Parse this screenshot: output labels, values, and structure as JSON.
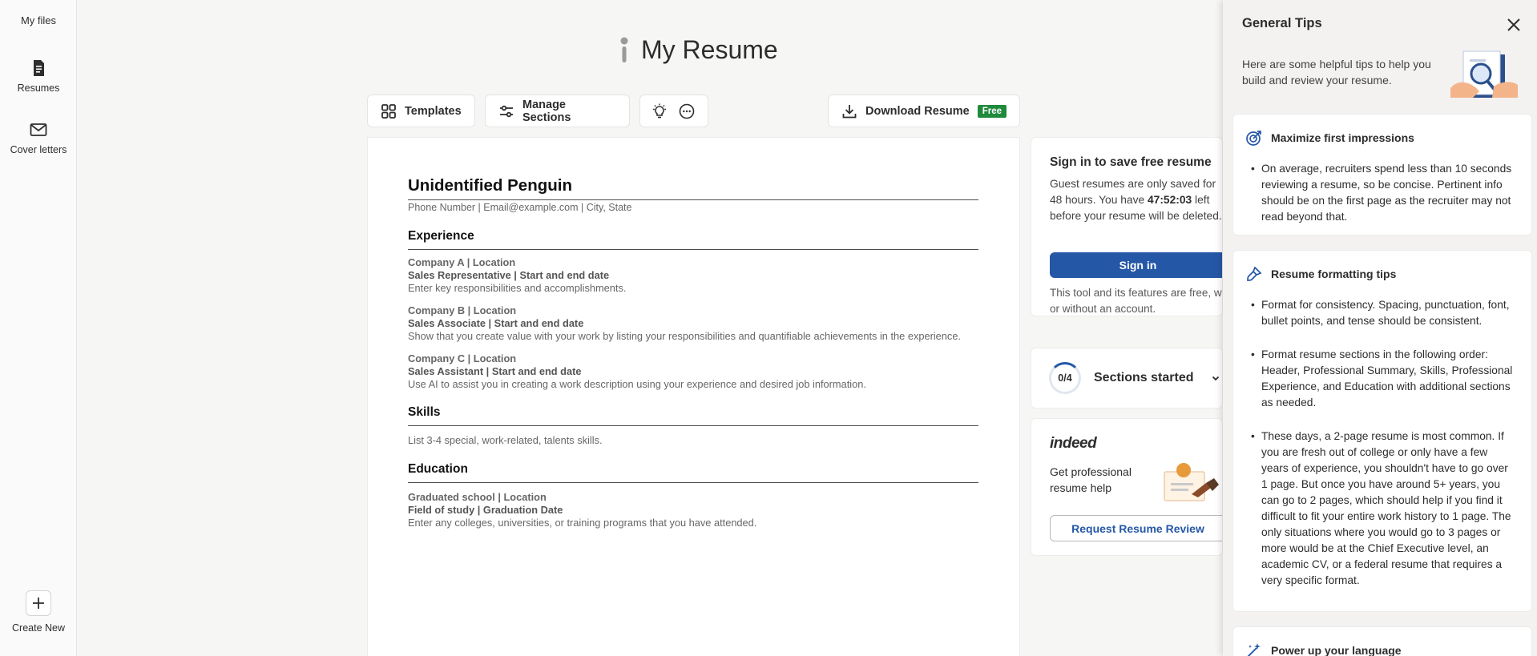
{
  "sidebar": {
    "my_files": "My files",
    "items": [
      {
        "label": "Resumes",
        "icon": "document-icon"
      },
      {
        "label": "Cover letters",
        "icon": "envelope-icon"
      }
    ],
    "create_new": "Create New"
  },
  "header": {
    "title": "My Resume"
  },
  "toolbar": {
    "templates": "Templates",
    "manage_sections": "Manage Sections",
    "download": "Download Resume",
    "free_badge": "Free"
  },
  "resume": {
    "name": "Unidentified Penguin",
    "contact": "Phone Number | Email@example.com | City, State",
    "experience_heading": "Experience",
    "experience": [
      {
        "company": "Company A | Location",
        "role": "Sales Representative | Start and end date",
        "desc": "Enter key responsibilities and accomplishments."
      },
      {
        "company": "Company B | Location",
        "role": "Sales Associate | Start and end date",
        "desc": "Show that you create value with your work by listing your responsibilities and quantifiable achievements in the experience."
      },
      {
        "company": "Company C | Location",
        "role": "Sales Assistant | Start and end date",
        "desc": "Use AI to assist you in creating a work description using your experience and desired job information."
      }
    ],
    "skills_heading": "Skills",
    "skills_text": "List 3-4 special, work-related, talents skills.",
    "education_heading": "Education",
    "education": {
      "school": "Graduated school | Location",
      "field": "Field of study | Graduation Date",
      "desc": "Enter any colleges, universities, or training programs that you have attended."
    }
  },
  "signin_card": {
    "title": "Sign in to save free resume",
    "text_before": "Guest resumes are only saved for 48 hours. You have ",
    "time_left": "47:52:03",
    "text_after": " left before your resume will be deleted.",
    "button": "Sign in",
    "note": "This tool and its features are free, with or without an account."
  },
  "sections_card": {
    "progress": "0/4",
    "label": "Sections started"
  },
  "indeed_card": {
    "logo": "indeed",
    "text": "Get professional resume help",
    "button": "Request Resume Review"
  },
  "tips_panel": {
    "title": "General Tips",
    "intro": "Here are some helpful tips to help you build and review your resume.",
    "sections": [
      {
        "title": "Maximize first impressions",
        "bullets": [
          "On average, recruiters spend less than 10 seconds reviewing a resume, so be concise. Pertinent info should be on the first page as the recruiter may not read beyond that."
        ]
      },
      {
        "title": "Resume formatting tips",
        "bullets": [
          "Format for consistency. Spacing, punctuation, font, bullet points, and tense should be consistent.",
          "Format resume sections in the following order: Header, Professional Summary, Skills, Professional Experience, and Education with additional sections as needed.",
          "These days, a 2-page resume is most common. If you are fresh out of college or only have a few years of experience, you shouldn't have to go over 1 page. But once you have around 5+ years, you can go to 2 pages, which should help if you find it difficult to fit your entire work history to 1 page. The only situations where you would go to 3 pages or more would be at the Chief Executive level, an academic CV, or a federal resume that requires a very specific format."
        ]
      },
      {
        "title": "Power up your language",
        "bullets": []
      }
    ]
  },
  "colors": {
    "accent": "#2557a7",
    "free_badge": "#1f8a3b"
  }
}
